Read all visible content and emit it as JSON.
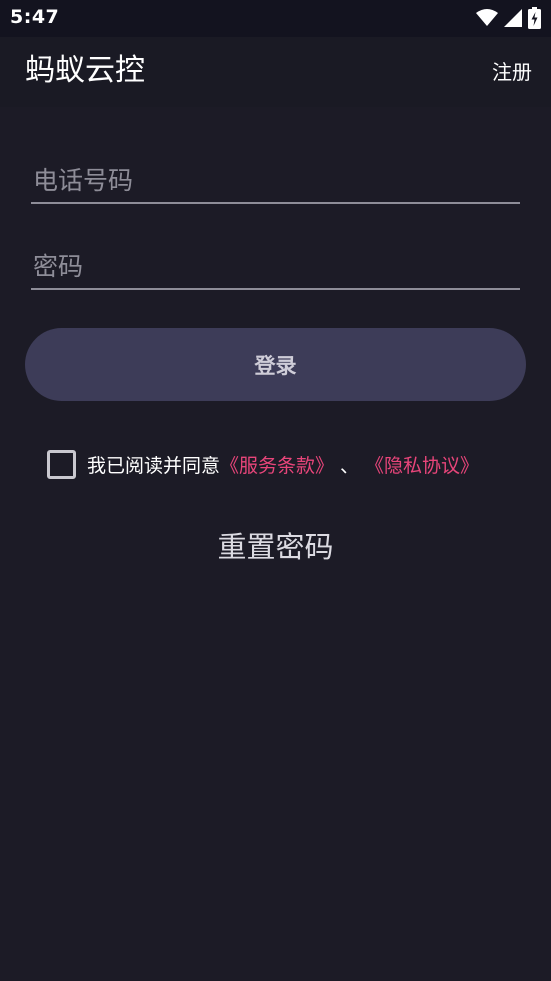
{
  "status_bar": {
    "time": "5:47",
    "icons": [
      "wifi-icon",
      "signal-icon",
      "battery-icon"
    ]
  },
  "app_bar": {
    "title": "蚂蚁云控",
    "register_label": "注册"
  },
  "form": {
    "phone_placeholder": "电话号码",
    "password_placeholder": "密码",
    "login_label": "登录"
  },
  "agreement": {
    "checked": false,
    "prefix": "我已阅读并同意",
    "terms_label": "《服务条款》",
    "separator": "、",
    "privacy_label": "《隐私协议》"
  },
  "reset_label": "重置密码",
  "colors": {
    "background": "#1c1b26",
    "status_bar": "#13131f",
    "button": "#3d3c58",
    "link_accent": "#e8457a",
    "underline": "#8e8d98"
  }
}
